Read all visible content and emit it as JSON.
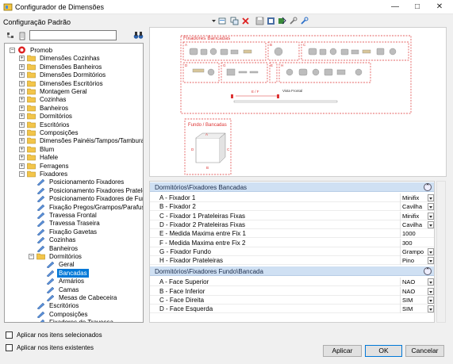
{
  "window": {
    "title": "Configurador de Dimensões",
    "minimize": "—",
    "maximize": "□",
    "close": "✕"
  },
  "config_label": "Configuração Padrão",
  "search": {
    "value": "",
    "placeholder": ""
  },
  "tree": [
    {
      "label": "Promob",
      "type": "root"
    },
    {
      "label": "Dimensões Cozinhas",
      "type": "folder"
    },
    {
      "label": "Dimensões Banheiros",
      "type": "folder"
    },
    {
      "label": "Dimensões Dormitórios",
      "type": "folder"
    },
    {
      "label": "Dimensões Escritórios",
      "type": "folder"
    },
    {
      "label": "Montagem Geral",
      "type": "folder"
    },
    {
      "label": "Cozinhas",
      "type": "folder"
    },
    {
      "label": "Banheiros",
      "type": "folder"
    },
    {
      "label": "Dormitórios",
      "type": "folder"
    },
    {
      "label": "Escritórios",
      "type": "folder"
    },
    {
      "label": "Composições",
      "type": "folder"
    },
    {
      "label": "Dimensões Painéis/Tampos/Tamburatos",
      "type": "folder"
    },
    {
      "label": "Blum",
      "type": "folder"
    },
    {
      "label": "Hafele",
      "type": "folder"
    },
    {
      "label": "Ferragens",
      "type": "folder"
    },
    {
      "label": "Fixadores",
      "type": "folder-open"
    },
    {
      "label": "Posicionamento Fixadores",
      "type": "item"
    },
    {
      "label": "Posicionamento Fixadores Prateleiras",
      "type": "item"
    },
    {
      "label": "Posicionamento Fixadores de Fundo",
      "type": "item"
    },
    {
      "label": "Fixação Pregos/Grampos/Parafusos",
      "type": "item"
    },
    {
      "label": "Travessa Frontal",
      "type": "item"
    },
    {
      "label": "Travessa Traseira",
      "type": "item"
    },
    {
      "label": "Fixação Gavetas",
      "type": "item"
    },
    {
      "label": "Cozinhas",
      "type": "item"
    },
    {
      "label": "Banheiros",
      "type": "item"
    },
    {
      "label": "Dormitórios",
      "type": "folder-open"
    },
    {
      "label": "Geral",
      "type": "item"
    },
    {
      "label": "Bancadas",
      "type": "item",
      "selected": true
    },
    {
      "label": "Armários",
      "type": "item"
    },
    {
      "label": "Camas",
      "type": "item"
    },
    {
      "label": "Mesas de Cabeceira",
      "type": "item"
    },
    {
      "label": "Escritórios",
      "type": "item"
    },
    {
      "label": "Composições",
      "type": "item"
    },
    {
      "label": "Fixadores de Travessa",
      "type": "item"
    }
  ],
  "checkboxes": {
    "selected_items": "Aplicar nos itens selecionados",
    "existing_items": "Aplicar nos itens existentes"
  },
  "preview": {
    "title_top": "Fixadores Bancadas",
    "letters": [
      "A",
      "B",
      "C",
      "D",
      "E",
      "F",
      "G",
      "H"
    ],
    "dimension_label": "E / F",
    "front_view": "Vista Frontal",
    "title_bottom": "Fundo / Bancadas",
    "fundo_letters": [
      "A",
      "B",
      "C",
      "D"
    ]
  },
  "properties": {
    "category1": {
      "title": "Dormitórios\\Fixadores Bancadas",
      "rows": [
        {
          "key": "A - Fixador 1",
          "value": "Minifix",
          "dropdown": true
        },
        {
          "key": "B - Fixador 2",
          "value": "Cavilha",
          "dropdown": true
        },
        {
          "key": "C - Fixador 1 Prateleiras Fixas",
          "value": "Minifix",
          "dropdown": true
        },
        {
          "key": "D - Fixador 2 Prateleiras Fixas",
          "value": "Cavilha",
          "dropdown": true
        },
        {
          "key": "E - Medida Maxima entre Fix 1",
          "value": "1000",
          "dropdown": false
        },
        {
          "key": "F - Medida Maxima entre Fix 2",
          "value": "300",
          "dropdown": false
        },
        {
          "key": "G - Fixador Fundo",
          "value": "Grampo",
          "dropdown": true
        },
        {
          "key": "H - Fixador Prateleiras",
          "value": "Pino",
          "dropdown": true
        }
      ]
    },
    "category2": {
      "title": "Dormitórios\\Fixadores Fundo\\Bancada",
      "rows": [
        {
          "key": "A - Face Superior",
          "value": "NAO",
          "dropdown": true
        },
        {
          "key": "B - Face Inferior",
          "value": "NAO",
          "dropdown": true
        },
        {
          "key": "C - Face Direita",
          "value": "SIM",
          "dropdown": true
        },
        {
          "key": "D - Face Esquerda",
          "value": "SIM",
          "dropdown": true
        }
      ]
    }
  },
  "buttons": {
    "apply": "Aplicar",
    "ok": "OK",
    "cancel": "Cancelar"
  }
}
